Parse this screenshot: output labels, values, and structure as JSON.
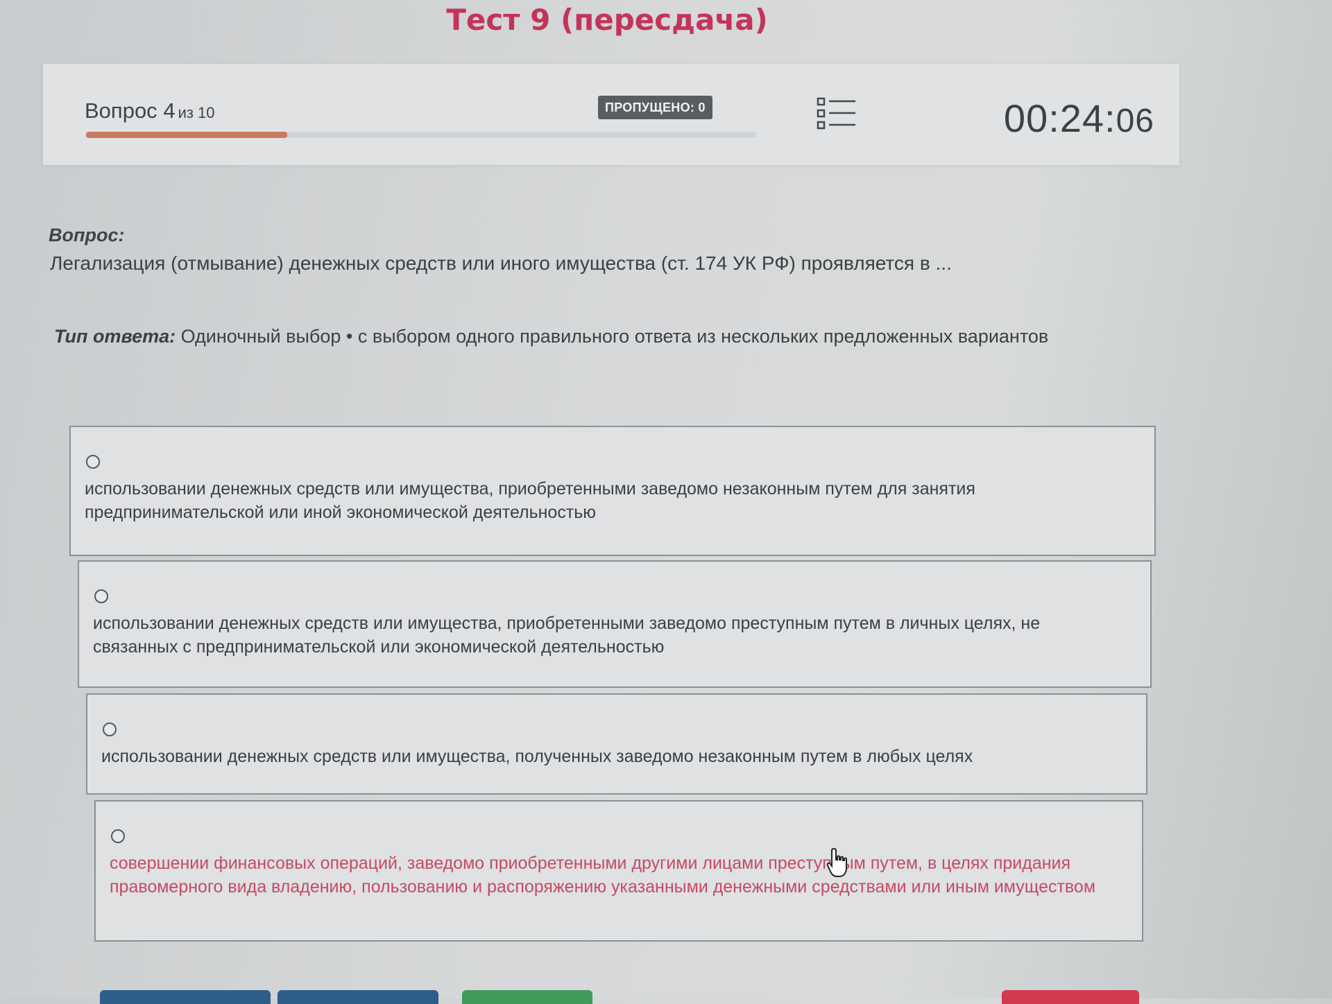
{
  "title": "Тест 9 (пересдача)",
  "header": {
    "question_prefix": "Вопрос",
    "question_number": "4",
    "question_of": "из 10",
    "progress": 0.3,
    "skipped_label": "ПРОПУЩЕНО: 0",
    "list_icon": "list-icon",
    "timer_main": "00:24:",
    "timer_seconds": "06"
  },
  "question": {
    "label": "Вопрос:",
    "text": "Легализация (отмывание) денежных средств или иного имущества (ст. 174 УК РФ) проявляется в ..."
  },
  "answer_type": {
    "label": "Тип ответа:",
    "text": "Одиночный выбор • с выбором одного правильного ответа из нескольких предложенных вариантов"
  },
  "options": [
    {
      "text": "использовании денежных средств или имущества, приобретенными заведомо незаконным путем для занятия предпринимательской или иной экономической деятельностью"
    },
    {
      "text": "использовании денежных средств или имущества, приобретенными заведомо преступным путем в личных целях, не связанных с предпринимательской или экономической деятельностью"
    },
    {
      "text": "использовании денежных средств или имущества, полученных заведомо незаконным путем в любых целях"
    },
    {
      "text": "совершении финансовых операций, заведомо приобретенными другими лицами преступным путем, в целях придания правомерного вида владению, пользованию и распоряжению указанными денежными средствами или иным имуществом"
    }
  ],
  "colors": {
    "title": "#c4345a",
    "progress": "#c97a5e",
    "highlight_text": "#c64a66",
    "btn_blue": "#2f5d8a",
    "btn_green": "#3f9a5b",
    "btn_red": "#d43a4f"
  }
}
